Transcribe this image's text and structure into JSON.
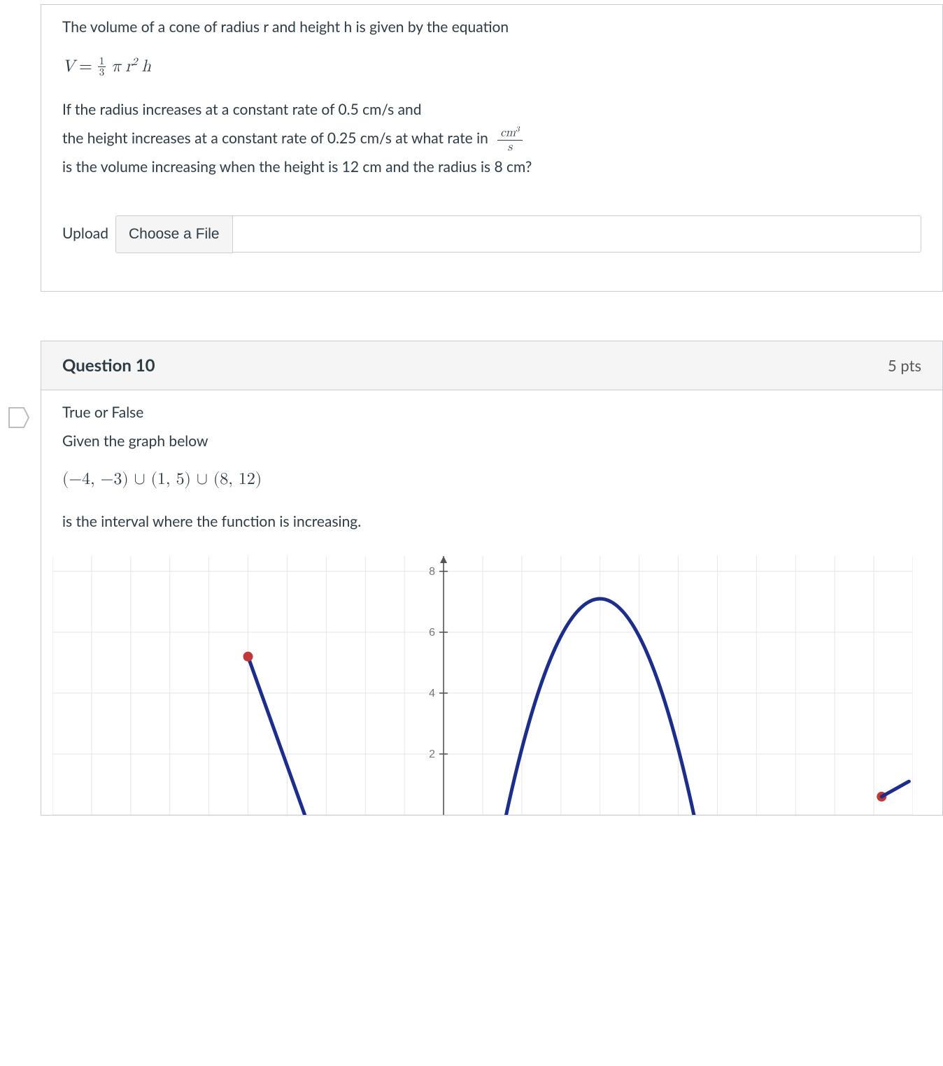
{
  "q9": {
    "line1": "The volume of a cone of radius r and height h is given by the equation",
    "formula": {
      "lhs": "V",
      "eq": "=",
      "frac_num": "1",
      "frac_den": "3",
      "pi": "π",
      "r": "r",
      "r_exp": "2",
      "h": "h"
    },
    "line2": "If the radius increases at a constant rate of 0.5 cm/s and",
    "line3_a": "the height increases at a constant rate of 0.25 cm/s at what rate in",
    "rate_unit": {
      "num_base": "cm",
      "num_exp": "3",
      "den": "s"
    },
    "line4": "is the volume increasing when the height is 12 cm and the radius is 8 cm?",
    "upload_label": "Upload",
    "choose_label": "Choose a File",
    "filename": ""
  },
  "q10": {
    "title": "Question 10",
    "points": "5 pts",
    "line1": "True or False",
    "line2": "Given the graph below",
    "intervals": "(−4,  −3) ∪ (1,  5) ∪ (8,  12)",
    "line3": "is the interval where the function is increasing."
  },
  "chart_data": {
    "type": "line",
    "title": "",
    "xlabel": "",
    "ylabel": "",
    "xlim": [
      -10,
      12
    ],
    "ylim": [
      0,
      8.5
    ],
    "y_ticks": [
      2,
      4,
      6,
      8
    ],
    "gridlines": {
      "x_step": 1,
      "y_step": 2
    },
    "series": [
      {
        "name": "piece-1",
        "kind": "segment",
        "points": [
          {
            "x": -5,
            "y": 5.2,
            "endpoint": "open"
          },
          {
            "x": -3.55,
            "y": 0.0
          }
        ]
      },
      {
        "name": "piece-2",
        "kind": "parabola",
        "vertex": {
          "x": 4,
          "y": 7.1
        },
        "left_root": {
          "x": 1.6,
          "y": 0.0
        },
        "right_root": {
          "x": 6.4,
          "y": 0.0
        }
      },
      {
        "name": "piece-3-start",
        "kind": "point",
        "points": [
          {
            "x": 11.2,
            "y": 0.6,
            "endpoint": "open"
          }
        ]
      }
    ]
  }
}
